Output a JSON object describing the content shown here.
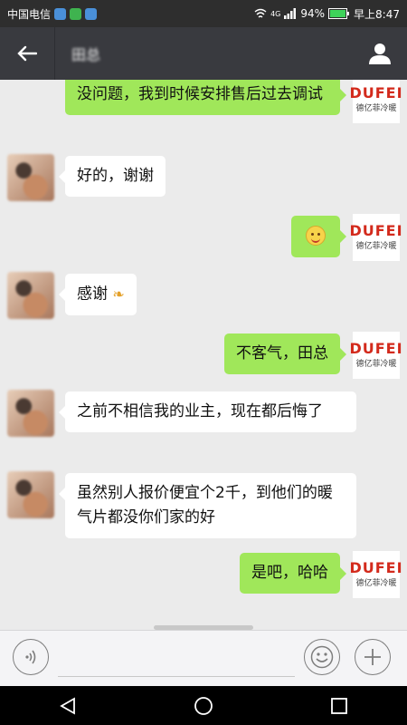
{
  "status_bar": {
    "carrier": "中国电信",
    "battery": "94%",
    "time": "早上8:47",
    "network": "4G"
  },
  "header": {
    "contact_name": "田总",
    "back_icon": "arrow-left-icon",
    "profile_icon": "person-icon"
  },
  "logo": {
    "main": "DUFEI",
    "sub": "德亿菲冷暖"
  },
  "messages": [
    {
      "side": "right",
      "text": "没问题，我到时候安排售后过去调试"
    },
    {
      "side": "left",
      "text": "好的，谢谢"
    },
    {
      "side": "right",
      "text": "",
      "emoji": "smile-emoji"
    },
    {
      "side": "left",
      "text": "感谢",
      "emoji": "praying-hands-emoji"
    },
    {
      "side": "right",
      "text": "不客气，田总"
    },
    {
      "side": "left",
      "text": "之前不相信我的业主，现在都后悔了"
    },
    {
      "side": "left",
      "text": "虽然别人报价便宜个2千，到他们的暖气片都没你们家的好"
    },
    {
      "side": "right",
      "text": "是吧，哈哈"
    }
  ],
  "input_bar": {
    "voice_icon": "voice-icon",
    "input_value": "",
    "emoji_icon": "emoji-icon",
    "plus_icon": "plus-icon"
  },
  "nav_bar": {
    "back_icon": "nav-back-icon",
    "home_icon": "nav-home-icon",
    "recents_icon": "nav-recents-icon"
  },
  "colors": {
    "title_bar": "#393a3f",
    "right_bubble": "#a0e75a",
    "left_bubble": "#ffffff",
    "chat_bg": "#ebebeb"
  }
}
